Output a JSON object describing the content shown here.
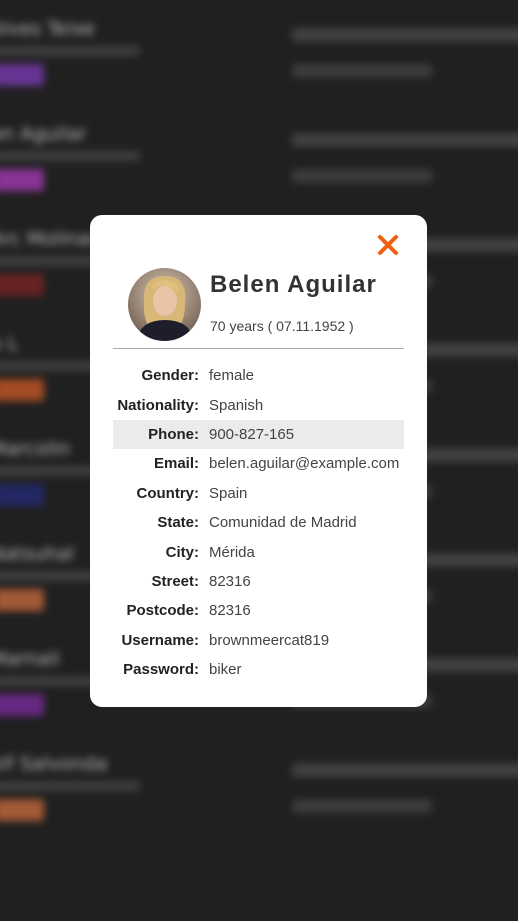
{
  "background": {
    "rows": [
      {
        "name": "Alves Teixe",
        "tag_color": "#7a3fb0"
      },
      {
        "name": "an Aguilar",
        "tag_color": "#a23fb0"
      },
      {
        "name": "Arc Molinar",
        "tag_color": "#7a2a2a"
      },
      {
        "name": "o L",
        "tag_color": "#c15a2a"
      },
      {
        "name": "Marcolin",
        "tag_color": "#2a2f78"
      },
      {
        "name": "Natsuhal",
        "tag_color": "#c06a40"
      },
      {
        "name": "Marnali",
        "tag_color": "#7a2f9a"
      },
      {
        "name": "eif Salvonda",
        "tag_color": "#c06a40"
      }
    ]
  },
  "modal": {
    "close_icon": "close-icon",
    "close_color": "#f06010",
    "name": "Belen Aguilar",
    "age_line": "70 years ( 07.11.1952 )",
    "details": [
      {
        "label": "Gender:",
        "value": "female"
      },
      {
        "label": "Nationality:",
        "value": "Spanish"
      },
      {
        "label": "Phone:",
        "value": "900-827-165",
        "highlight": true
      },
      {
        "label": "Email:",
        "value": "belen.aguilar@example.com"
      },
      {
        "label": "Country:",
        "value": "Spain"
      },
      {
        "label": "State:",
        "value": "Comunidad de Madrid"
      },
      {
        "label": "City:",
        "value": "Mérida"
      },
      {
        "label": "Street:",
        "value": "82316"
      },
      {
        "label": "Postcode:",
        "value": "82316"
      },
      {
        "label": "Username:",
        "value": "brownmeercat819"
      },
      {
        "label": "Password:",
        "value": "biker"
      }
    ]
  }
}
